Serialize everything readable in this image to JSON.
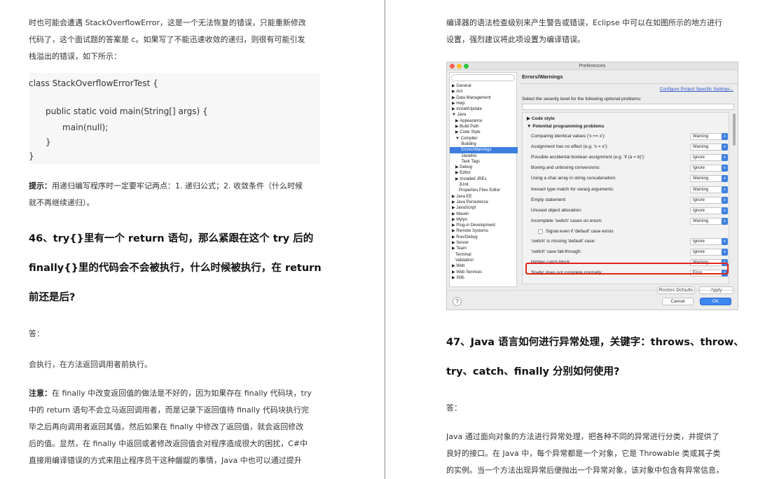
{
  "left": {
    "intro": "时也可能会遭遇 StackOverflowError，这是一个无法恢复的错误，只能重新修改代码了，这个面试题的答案是 c。如果写了不能迅速收敛的递归，则很有可能引发栈溢出的错误，如下所示：",
    "intro_l1": "时也可能会遭遇 StackOverflowError，这是一个无法恢复的错误，只能重新修改",
    "intro_l2": "代码了，这个面试题的答案是 c。如果写了不能迅速收敛的递归，则很有可能引发",
    "intro_l3": "栈溢出的错误，如下所示：",
    "code": {
      "line1": "class StackOverflowErrorTest {",
      "line2": "public static void main(String[] args) {",
      "line3": "main(null);",
      "line4": "}",
      "line5": "}"
    },
    "tip_label": "提示：",
    "tip_l1": "用递归编写程序时一定要牢记两点：1. 递归公式；2. 收敛条件（什么时候",
    "tip_l2": "就不再继续递归）。",
    "q46_l1": "46、try{}里有一个 return 语句，那么紧跟在这个 try 后的",
    "q46_l2": "finally{}里的代码会不会被执行，什么时候被执行，在 return",
    "q46_l3": "前还是后?",
    "answer_label": "答：",
    "answer": "会执行，在方法返回调用者前执行。",
    "note_label": "注意：",
    "note_l1": "在 finally 中改变返回值的做法是不好的，因为如果存在 finally 代码块，try",
    "note_l2": "中的 return 语句不会立马返回调用者，而是记录下返回值待 finally 代码块执行完",
    "note_l3": "毕之后再向调用者返回其值，然后如果在 finally 中修改了返回值，就会返回修改",
    "note_l4": "后的值。显然，在 finally 中返回或者修改返回值会对程序造成很大的困扰，C#中",
    "note_l5": "直接用编译错误的方式来阻止程序员干这种龌龊的事情，Java 中也可以通过提升"
  },
  "right": {
    "top_l1": "编译器的语法检查级别来产生警告或错误，Eclipse 中可以在如图所示的地方进行",
    "top_l2": "设置，强烈建议将此项设置为编译错误。",
    "q47_l1": "47、Java 语言如何进行异常处理，关键字：throws、throw、",
    "q47_l2": "try、catch、finally 分别如何使用?",
    "answer_label": "答：",
    "p_l1": "Java 通过面向对象的方法进行异常处理，把各种不同的异常进行分类，并提供了",
    "p_l2": "良好的接口。在 Java 中，每个异常都是一个对象，它是 Throwable 类或其子类",
    "p_l3": "的实例。当一个方法出现异常后便抛出一个异常对象，该对象中包含有异常信息，"
  },
  "prefs": {
    "title": "Preferences",
    "header": "Errors/Warnings",
    "configure_link": "Configure Project Specific Settings...",
    "severity_label": "Select the severity level for the following optional problems:",
    "section_code_style": "Code style",
    "section_potential": "Potential programming problems",
    "tree": [
      "▶ General",
      "▶ Ant",
      "▶ Data Management",
      "▶ Help",
      "▶ Install/Update",
      "▼ Java",
      "   ▶ Appearance",
      "   ▶ Build Path",
      "   ▶ Code Style",
      "   ▼ Compiler",
      "        Building",
      "        Errors/Warnings",
      "        Javadoc",
      "        Task Tags",
      "   ▶ Debug",
      "   ▶ Editor",
      "   ▶ Installed JREs",
      "      JUnit",
      "      Properties Files Editor",
      "▶ Java EE",
      "▶ Java Persistence",
      "▶ JavaScript",
      "▶ Maven",
      "▶ Mylyn",
      "▶ Plug-in Development",
      "▶ Remote Systems",
      "▶ Run/Debug",
      "▶ Server",
      "▶ Team",
      "   Terminal",
      "   Validation",
      "▶ Web",
      "▶ Web Services",
      "▶ XML"
    ],
    "rows": [
      {
        "label": "Comparing identical values ('x == x'):",
        "value": "Warning"
      },
      {
        "label": "Assignment has no effect (e.g. 'x = x'):",
        "value": "Warning"
      },
      {
        "label": "Possible accidental boolean assignment (e.g. 'if (a = b)'):",
        "value": "Ignore"
      },
      {
        "label": "Boxing and unboxing conversions:",
        "value": "Ignore"
      },
      {
        "label": "Using a char array in string concatenation:",
        "value": "Warning"
      },
      {
        "label": "Inexact type match for vararg arguments:",
        "value": "Warning"
      },
      {
        "label": "Empty statement:",
        "value": "Ignore"
      },
      {
        "label": "Unused object allocation:",
        "value": "Ignore"
      },
      {
        "label": "Incomplete 'switch' cases on enum:",
        "value": "Warning"
      }
    ],
    "signal_label": "Signal even if 'default' case exists",
    "rows2": [
      {
        "label": "'switch' is missing 'default' case:",
        "value": "Ignore"
      },
      {
        "label": "'switch' case fall-through:",
        "value": "Ignore"
      },
      {
        "label": "Hidden catch block:",
        "value": "Warning"
      },
      {
        "label": "'finally' does not complete normally:",
        "value": "Error"
      }
    ],
    "restore_defaults": "Restore Defaults",
    "apply": "Apply",
    "cancel": "Cancel",
    "ok": "OK",
    "help": "?"
  }
}
